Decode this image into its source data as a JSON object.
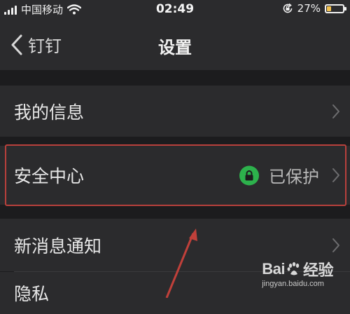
{
  "status_bar": {
    "carrier": "中国移动",
    "time": "02:49",
    "battery_percent": "27%",
    "battery_level": 0.27,
    "battery_color": "#f2c14e"
  },
  "nav": {
    "back_label": "钉钉",
    "title": "设置"
  },
  "settings": {
    "my_info_label": "我的信息",
    "security_label": "安全中心",
    "security_status": "已保护",
    "notification_label": "新消息通知",
    "privacy_label": "隐私"
  },
  "colors": {
    "background": "#1c1c1e",
    "row_background": "#2b2b2d",
    "protected_badge": "#2db14c",
    "highlight": "#b8403c"
  },
  "icons": {
    "back": "chevron-left-icon",
    "row_arrow": "chevron-right-icon",
    "security_badge": "lock-icon",
    "wifi": "wifi-icon",
    "signal": "signal-icon",
    "battery": "battery-icon",
    "rotation_lock": "rotation-lock-icon"
  },
  "watermark": {
    "brand_left": "Bai",
    "brand_right": "经验",
    "url": "jingyan.baidu.com"
  }
}
